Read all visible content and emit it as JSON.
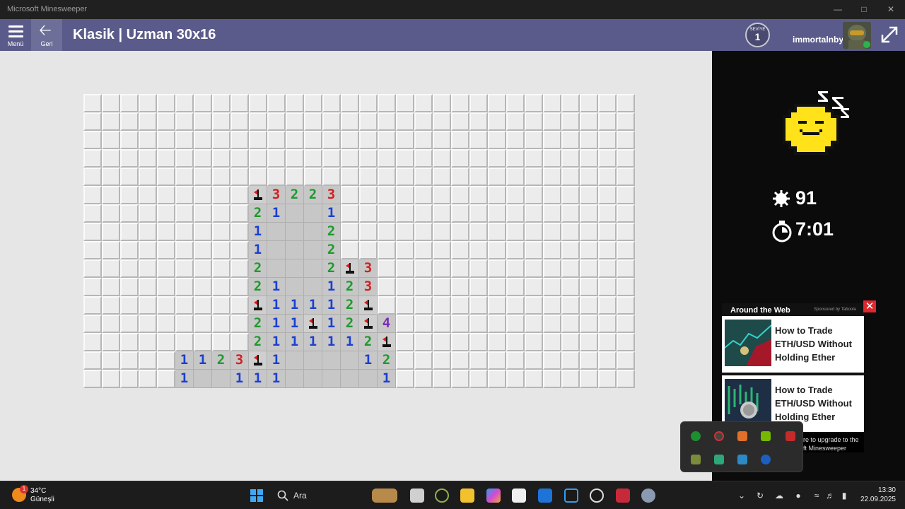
{
  "window": {
    "title": "Microsoft Minesweeper"
  },
  "header": {
    "menu_label": "Menü",
    "back_label": "Geri",
    "title": "Klasik | Uzman 30x16",
    "level_label": "SEVİYE",
    "level_value": "1",
    "username": "immortalnby"
  },
  "board": {
    "cols": 30,
    "rows": 16,
    "cells": [
      {
        "r": 5,
        "c": 9,
        "v": "F"
      },
      {
        "r": 5,
        "c": 10,
        "v": "3"
      },
      {
        "r": 5,
        "c": 11,
        "v": "2"
      },
      {
        "r": 5,
        "c": 12,
        "v": "2"
      },
      {
        "r": 5,
        "c": 13,
        "v": "3"
      },
      {
        "r": 6,
        "c": 9,
        "v": "2"
      },
      {
        "r": 6,
        "c": 10,
        "v": "1"
      },
      {
        "r": 6,
        "c": 11,
        "v": "0"
      },
      {
        "r": 6,
        "c": 12,
        "v": "0"
      },
      {
        "r": 6,
        "c": 13,
        "v": "1"
      },
      {
        "r": 7,
        "c": 9,
        "v": "1"
      },
      {
        "r": 7,
        "c": 10,
        "v": "0"
      },
      {
        "r": 7,
        "c": 11,
        "v": "0"
      },
      {
        "r": 7,
        "c": 12,
        "v": "0"
      },
      {
        "r": 7,
        "c": 13,
        "v": "2"
      },
      {
        "r": 8,
        "c": 9,
        "v": "1"
      },
      {
        "r": 8,
        "c": 10,
        "v": "0"
      },
      {
        "r": 8,
        "c": 11,
        "v": "0"
      },
      {
        "r": 8,
        "c": 12,
        "v": "0"
      },
      {
        "r": 8,
        "c": 13,
        "v": "2"
      },
      {
        "r": 9,
        "c": 9,
        "v": "2"
      },
      {
        "r": 9,
        "c": 10,
        "v": "0"
      },
      {
        "r": 9,
        "c": 11,
        "v": "0"
      },
      {
        "r": 9,
        "c": 12,
        "v": "0"
      },
      {
        "r": 9,
        "c": 13,
        "v": "2"
      },
      {
        "r": 9,
        "c": 14,
        "v": "F"
      },
      {
        "r": 9,
        "c": 15,
        "v": "3"
      },
      {
        "r": 10,
        "c": 9,
        "v": "2"
      },
      {
        "r": 10,
        "c": 10,
        "v": "1"
      },
      {
        "r": 10,
        "c": 11,
        "v": "0"
      },
      {
        "r": 10,
        "c": 12,
        "v": "0"
      },
      {
        "r": 10,
        "c": 13,
        "v": "1"
      },
      {
        "r": 10,
        "c": 14,
        "v": "2"
      },
      {
        "r": 10,
        "c": 15,
        "v": "3"
      },
      {
        "r": 11,
        "c": 9,
        "v": "F"
      },
      {
        "r": 11,
        "c": 10,
        "v": "1"
      },
      {
        "r": 11,
        "c": 11,
        "v": "1"
      },
      {
        "r": 11,
        "c": 12,
        "v": "1"
      },
      {
        "r": 11,
        "c": 13,
        "v": "1"
      },
      {
        "r": 11,
        "c": 14,
        "v": "2"
      },
      {
        "r": 11,
        "c": 15,
        "v": "F"
      },
      {
        "r": 12,
        "c": 9,
        "v": "2"
      },
      {
        "r": 12,
        "c": 10,
        "v": "1"
      },
      {
        "r": 12,
        "c": 11,
        "v": "1"
      },
      {
        "r": 12,
        "c": 12,
        "v": "F"
      },
      {
        "r": 12,
        "c": 13,
        "v": "1"
      },
      {
        "r": 12,
        "c": 14,
        "v": "2"
      },
      {
        "r": 12,
        "c": 15,
        "v": "F"
      },
      {
        "r": 12,
        "c": 16,
        "v": "4"
      },
      {
        "r": 13,
        "c": 9,
        "v": "2"
      },
      {
        "r": 13,
        "c": 10,
        "v": "1"
      },
      {
        "r": 13,
        "c": 11,
        "v": "1"
      },
      {
        "r": 13,
        "c": 12,
        "v": "1"
      },
      {
        "r": 13,
        "c": 13,
        "v": "1"
      },
      {
        "r": 13,
        "c": 14,
        "v": "1"
      },
      {
        "r": 13,
        "c": 15,
        "v": "2"
      },
      {
        "r": 13,
        "c": 16,
        "v": "F"
      },
      {
        "r": 14,
        "c": 5,
        "v": "1"
      },
      {
        "r": 14,
        "c": 6,
        "v": "1"
      },
      {
        "r": 14,
        "c": 7,
        "v": "2"
      },
      {
        "r": 14,
        "c": 8,
        "v": "3"
      },
      {
        "r": 14,
        "c": 9,
        "v": "F"
      },
      {
        "r": 14,
        "c": 10,
        "v": "1"
      },
      {
        "r": 14,
        "c": 11,
        "v": "0"
      },
      {
        "r": 14,
        "c": 12,
        "v": "0"
      },
      {
        "r": 14,
        "c": 13,
        "v": "0"
      },
      {
        "r": 14,
        "c": 14,
        "v": "0"
      },
      {
        "r": 14,
        "c": 15,
        "v": "1"
      },
      {
        "r": 14,
        "c": 16,
        "v": "2"
      },
      {
        "r": 15,
        "c": 5,
        "v": "1"
      },
      {
        "r": 15,
        "c": 6,
        "v": "0"
      },
      {
        "r": 15,
        "c": 7,
        "v": "0"
      },
      {
        "r": 15,
        "c": 8,
        "v": "1"
      },
      {
        "r": 15,
        "c": 9,
        "v": "1"
      },
      {
        "r": 15,
        "c": 10,
        "v": "1"
      },
      {
        "r": 15,
        "c": 11,
        "v": "0"
      },
      {
        "r": 15,
        "c": 12,
        "v": "0"
      },
      {
        "r": 15,
        "c": 13,
        "v": "0"
      },
      {
        "r": 15,
        "c": 14,
        "v": "0"
      },
      {
        "r": 15,
        "c": 15,
        "v": "0"
      },
      {
        "r": 15,
        "c": 16,
        "v": "1"
      }
    ]
  },
  "stats": {
    "mines_left": "91",
    "timer": "7:01",
    "smiley_state": "sleeping-smiley-icon"
  },
  "ad": {
    "heading": "Around the Web",
    "sponsor": "Sponsored by Taboola",
    "items": [
      {
        "headline": "How to Trade ETH/USD Without Holding Ether"
      },
      {
        "headline": "How to Trade ETH/USD Without Holding Ether"
      }
    ],
    "footer": "re to upgrade to the\nft Minesweeper"
  },
  "taskbar": {
    "weather_temp": "34°C",
    "weather_desc": "Güneşli",
    "weather_badge": "1",
    "search_label": "Ara",
    "time": "13:30",
    "date": "22.09.2025"
  },
  "colors": {
    "n1": "#1b3fd2",
    "n2": "#1e9a2c",
    "n3": "#d21f1f",
    "n4": "#7c2bb6",
    "header": "#5a5b8a"
  }
}
